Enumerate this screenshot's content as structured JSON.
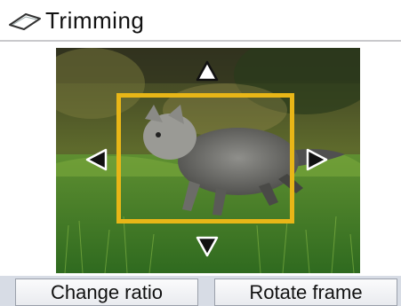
{
  "header": {
    "title": "Trimming",
    "icon": "trimming-icon"
  },
  "preview": {
    "subject": "cat-photo",
    "frame_color": "#e8b617",
    "arrows": [
      "arrow-up-icon",
      "arrow-down-icon",
      "arrow-left-icon",
      "arrow-right-icon"
    ]
  },
  "buttons": {
    "left": "Change ratio",
    "right": "Rotate frame"
  }
}
